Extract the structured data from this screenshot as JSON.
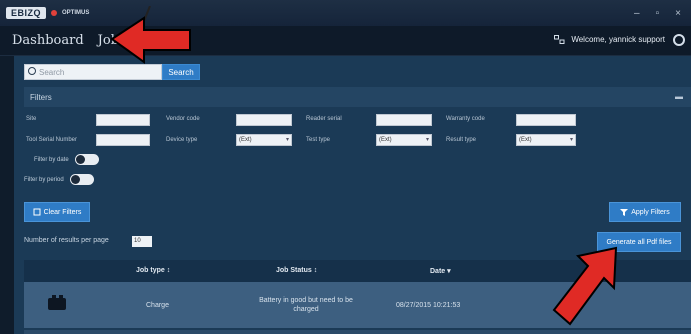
{
  "app": {
    "logo_text": "EBIZQ",
    "logo_sub": "OPTIMUS"
  },
  "window_controls": [
    "–",
    "▫",
    "×"
  ],
  "nav": {
    "dashboard": "Dashboard",
    "jobs": "Jobs"
  },
  "header": {
    "welcome": "Welcome, yannick support"
  },
  "search": {
    "placeholder": "Search",
    "button": "Search"
  },
  "filters": {
    "title": "Filters",
    "fields": [
      {
        "label": "Site",
        "value": ""
      },
      {
        "label": "Vendor code",
        "value": ""
      },
      {
        "label": "Reader serial",
        "value": ""
      },
      {
        "label": "Warranty code",
        "value": ""
      },
      {
        "label": "Tool Serial Number",
        "value": ""
      },
      {
        "label": "Device type",
        "value": "(Ext)"
      },
      {
        "label": "Test type",
        "value": "(Ext)"
      },
      {
        "label": "Result type",
        "value": "(Ext)"
      }
    ],
    "filter_by_date": "Filter by date",
    "filter_by_period": "Filter by period",
    "clear_button": "Clear Filters",
    "apply_button": "Apply Filters"
  },
  "results": {
    "label": "Number of results per page",
    "value": "10"
  },
  "export_button": "Generate all Pdf files",
  "table": {
    "columns": [
      "Job type ↕",
      "Job Status ↕",
      "Date ▾"
    ],
    "rows": [
      {
        "job_type": "Charge",
        "job_status": "Battery in good but need to be charged",
        "date": "08/27/2015 10:21:53"
      }
    ]
  },
  "colors": {
    "accent": "#2f7cc6",
    "arrow": "#e02a25"
  }
}
